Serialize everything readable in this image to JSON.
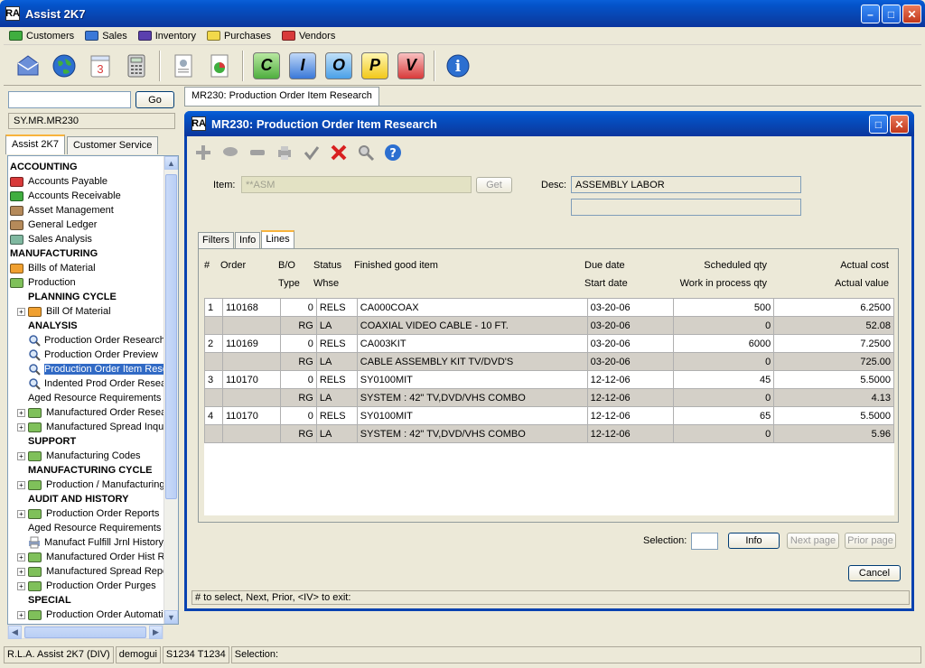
{
  "window": {
    "title": "Assist 2K7",
    "logo": "RA"
  },
  "menu": [
    {
      "label": "Customers",
      "color": "#3fae3f"
    },
    {
      "label": "Sales",
      "color": "#3a78d8"
    },
    {
      "label": "Inventory",
      "color": "#5a3fae"
    },
    {
      "label": "Purchases",
      "color": "#f2d94a"
    },
    {
      "label": "Vendors",
      "color": "#d83a3a"
    }
  ],
  "toolbar": {
    "icons": [
      "envelope-icon",
      "globe-icon",
      "calendar-icon",
      "calculator-icon",
      "document-icon",
      "chart-icon",
      "c-icon",
      "i-icon",
      "o-icon",
      "p-icon",
      "v-icon",
      "info-icon"
    ],
    "calendar_day": "3",
    "letters": [
      "C",
      "I",
      "O",
      "P",
      "V"
    ],
    "info_glyph": "i"
  },
  "left": {
    "go_label": "Go",
    "path": "SY.MR.MR230",
    "tabs": [
      "Assist 2K7",
      "Customer Service"
    ],
    "tree": [
      {
        "label": "ACCOUNTING",
        "type": "header",
        "indent": 0
      },
      {
        "label": "Accounts Payable",
        "type": "folder",
        "color": "#d83a3a",
        "indent": 0
      },
      {
        "label": "Accounts Receivable",
        "type": "folder",
        "color": "#3fae3f",
        "indent": 0
      },
      {
        "label": "Asset Management",
        "type": "folder",
        "color": "#b58a5a",
        "indent": 0
      },
      {
        "label": "General Ledger",
        "type": "folder",
        "color": "#b58a5a",
        "indent": 0
      },
      {
        "label": "Sales Analysis",
        "type": "folder",
        "color": "#7fb8a0",
        "indent": 0
      },
      {
        "label": "MANUFACTURING",
        "type": "header",
        "indent": 0
      },
      {
        "label": "Bills of Material",
        "type": "folder",
        "color": "#f0a030",
        "indent": 0
      },
      {
        "label": "Production",
        "type": "folder",
        "color": "#7fc05a",
        "indent": 0
      },
      {
        "label": "PLANNING CYCLE",
        "type": "header",
        "indent": 20
      },
      {
        "label": "Bill Of Material",
        "type": "folder",
        "color": "#f0a030",
        "indent": 8,
        "expand": true
      },
      {
        "label": "ANALYSIS",
        "type": "header",
        "indent": 20
      },
      {
        "label": "Production Order Research",
        "type": "search",
        "indent": 20
      },
      {
        "label": "Production Order Preview",
        "type": "search",
        "indent": 20
      },
      {
        "label": "Production Order Item Research",
        "type": "search",
        "indent": 20,
        "selected": true
      },
      {
        "label": "Indented Prod Order Research",
        "type": "search",
        "indent": 20
      },
      {
        "label": "Aged Resource Requirements",
        "type": "text",
        "indent": 20
      },
      {
        "label": "Manufactured Order Research",
        "type": "folder",
        "color": "#7fc05a",
        "indent": 8,
        "expand": true
      },
      {
        "label": "Manufactured Spread Inquiry",
        "type": "folder",
        "color": "#7fc05a",
        "indent": 8,
        "expand": true
      },
      {
        "label": "SUPPORT",
        "type": "header",
        "indent": 20
      },
      {
        "label": "Manufacturing Codes",
        "type": "folder",
        "color": "#7fc05a",
        "indent": 8,
        "expand": true
      },
      {
        "label": "MANUFACTURING CYCLE",
        "type": "header",
        "indent": 20
      },
      {
        "label": "Production / Manufacturing",
        "type": "folder",
        "color": "#7fc05a",
        "indent": 8,
        "expand": true
      },
      {
        "label": "AUDIT AND HISTORY",
        "type": "header",
        "indent": 20
      },
      {
        "label": "Production Order Reports",
        "type": "folder",
        "color": "#7fc05a",
        "indent": 8,
        "expand": true
      },
      {
        "label": "Aged Resource Requirements R",
        "type": "text",
        "indent": 20
      },
      {
        "label": "Manufact Fulfill Jrnl History",
        "type": "printer",
        "indent": 20
      },
      {
        "label": "Manufactured Order Hist R",
        "type": "folder",
        "color": "#7fc05a",
        "indent": 8,
        "expand": true
      },
      {
        "label": "Manufactured Spread Repo",
        "type": "folder",
        "color": "#7fc05a",
        "indent": 8,
        "expand": true
      },
      {
        "label": "Production Order Purges",
        "type": "folder",
        "color": "#7fc05a",
        "indent": 8,
        "expand": true
      },
      {
        "label": "SPECIAL",
        "type": "header",
        "indent": 20
      },
      {
        "label": "Production Order Automati",
        "type": "folder",
        "color": "#7fc05a",
        "indent": 8,
        "expand": true
      }
    ]
  },
  "doc_tab": "MR230: Production Order Item Research",
  "dialog": {
    "title": "MR230: Production Order Item Research",
    "item_label": "Item:",
    "item_value": "**ASM",
    "get_label": "Get",
    "desc_label": "Desc:",
    "desc_value": "ASSEMBLY LABOR",
    "desc2_value": "",
    "tabs": [
      "Filters",
      "Info",
      "Lines"
    ],
    "headers": {
      "num": "#",
      "order": "Order",
      "bo": "B/O",
      "type": "Type",
      "status": "Status",
      "whse": "Whse",
      "fg": "Finished good item",
      "due": "Due date",
      "start": "Start date",
      "sched": "Scheduled qty",
      "wip": "Work in process qty",
      "cost": "Actual cost",
      "value": "Actual value"
    },
    "rows": [
      {
        "num": "1",
        "order": "110168",
        "bo": "0",
        "status": "RELS",
        "item": "CA000COAX",
        "due": "03-20-06",
        "qty": "500",
        "cost": "6.2500",
        "type": "RG",
        "whse": "LA",
        "desc": "COAXIAL VIDEO CABLE - 10 FT.",
        "start": "03-20-06",
        "wip": "0",
        "value": "52.08"
      },
      {
        "num": "2",
        "order": "110169",
        "bo": "0",
        "status": "RELS",
        "item": "CA003KIT",
        "due": "03-20-06",
        "qty": "6000",
        "cost": "7.2500",
        "type": "RG",
        "whse": "LA",
        "desc": "CABLE ASSEMBLY KIT TV/DVD'S",
        "start": "03-20-06",
        "wip": "0",
        "value": "725.00"
      },
      {
        "num": "3",
        "order": "110170",
        "bo": "0",
        "status": "RELS",
        "item": "SY0100MIT",
        "due": "12-12-06",
        "qty": "45",
        "cost": "5.5000",
        "type": "RG",
        "whse": "LA",
        "desc": "SYSTEM : 42\" TV,DVD/VHS COMBO",
        "start": "12-12-06",
        "wip": "0",
        "value": "4.13"
      },
      {
        "num": "4",
        "order": "110170",
        "bo": "0",
        "status": "RELS",
        "item": "SY0100MIT",
        "due": "12-12-06",
        "qty": "65",
        "cost": "5.5000",
        "type": "RG",
        "whse": "LA",
        "desc": "SYSTEM : 42\" TV,DVD/VHS COMBO",
        "start": "12-12-06",
        "wip": "0",
        "value": "5.96"
      }
    ],
    "selection_label": "Selection:",
    "info_btn": "Info",
    "next_btn": "Next page",
    "prior_btn": "Prior page",
    "cancel_btn": "Cancel",
    "hint": "# to select,  Next,  Prior,  <IV> to exit:"
  },
  "status": {
    "company": "R.L.A. Assist 2K7 (DIV)",
    "user": "demogui",
    "terminal": "S1234 T1234",
    "selection": "Selection:"
  }
}
